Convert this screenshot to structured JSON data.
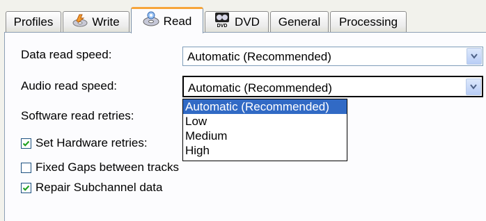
{
  "tabs": [
    {
      "label": "Profiles",
      "icon": "none"
    },
    {
      "label": "Write",
      "icon": "disc-write-icon"
    },
    {
      "label": "Read",
      "icon": "disc-read-icon",
      "active": true
    },
    {
      "label": "DVD",
      "icon": "dvd-icon"
    },
    {
      "label": "General",
      "icon": "none"
    },
    {
      "label": "Processing",
      "icon": "none"
    }
  ],
  "fields": {
    "data_read_speed": {
      "label": "Data read speed:",
      "value": "Automatic (Recommended)"
    },
    "audio_read_speed": {
      "label": "Audio read speed:",
      "value": "Automatic (Recommended)"
    },
    "software_read_retries": {
      "label": "Software read retries:"
    }
  },
  "dropdown": {
    "options": [
      "Automatic (Recommended)",
      "Low",
      "Medium",
      "High"
    ],
    "selected_index": 0
  },
  "checkboxes": [
    {
      "label": "Set Hardware retries:",
      "checked": true
    },
    {
      "label": "Fixed Gaps between tracks",
      "checked": false
    },
    {
      "label": "Repair Subchannel data",
      "checked": true
    }
  ],
  "colors": {
    "accent": "#f7a53a",
    "selection": "#316ac5",
    "check": "#21a121"
  }
}
